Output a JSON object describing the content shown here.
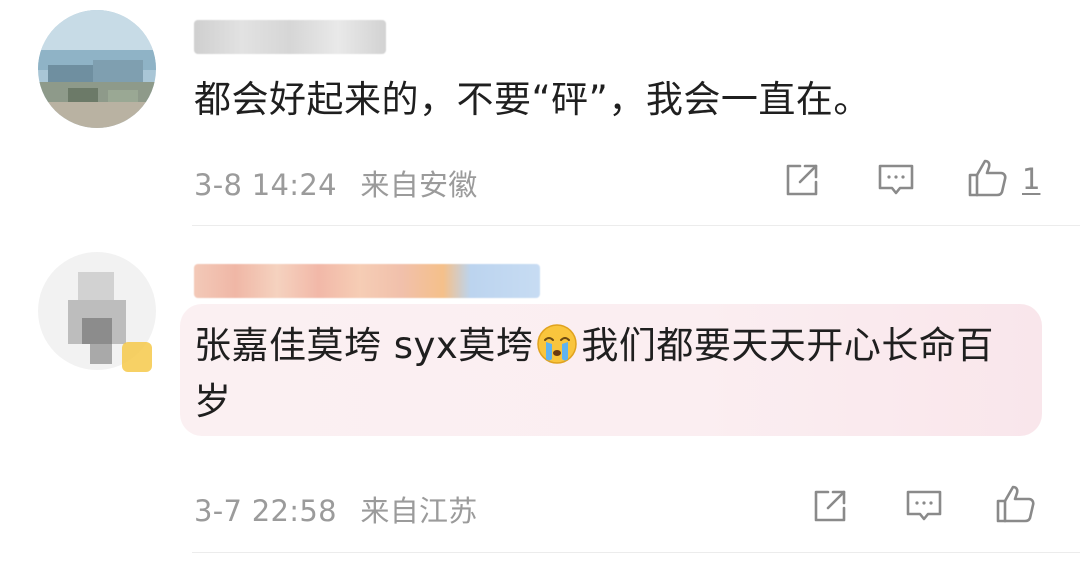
{
  "comments": [
    {
      "text": "都会好起来的，不要“砰”，我会一直在。",
      "meta_date": "3-8 14:24",
      "meta_location": "来自安徽",
      "like_count": "1",
      "actions": [
        "share-icon",
        "comment-icon",
        "thumbs-up-icon"
      ]
    },
    {
      "text_before_emoji": "张嘉佳莫垮 syx莫垮",
      "emoji": "crying-face-emoji",
      "text_after_emoji": "我们都要天天开心长命百岁",
      "meta_date": "3-7 22:58",
      "meta_location": "来自江苏",
      "actions": [
        "share-icon",
        "comment-icon",
        "thumbs-up-icon"
      ]
    }
  ],
  "colors": {
    "meta_text": "#9b9b9b",
    "icon_stroke": "#8a8a8a",
    "highlight_bubble": "#fbeef1",
    "divider": "#ececec"
  }
}
